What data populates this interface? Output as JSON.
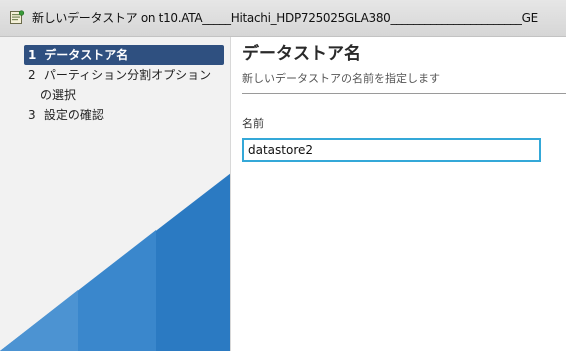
{
  "window": {
    "title": "新しいデータストア on t10.ATA_____Hitachi_HDP725025GLA380_______________________GE"
  },
  "sidebar": {
    "steps": [
      {
        "number": "1",
        "label": "データストア名",
        "active": true
      },
      {
        "number": "2",
        "label": "パーティション分割オプション",
        "label_cont": "の選択",
        "active": false
      },
      {
        "number": "3",
        "label": "設定の確認",
        "active": false
      }
    ]
  },
  "main": {
    "title": "データストア名",
    "subtitle": "新しいデータストアの名前を指定します",
    "name_field": {
      "label": "名前",
      "value": "datastore2"
    }
  },
  "colors": {
    "active_step_bg": "#2f5080",
    "input_focus_border": "#34a8d8",
    "sidebar_accent": "#2b7ac2"
  },
  "icons": {
    "title_icon": "datastore-wizard-icon"
  }
}
